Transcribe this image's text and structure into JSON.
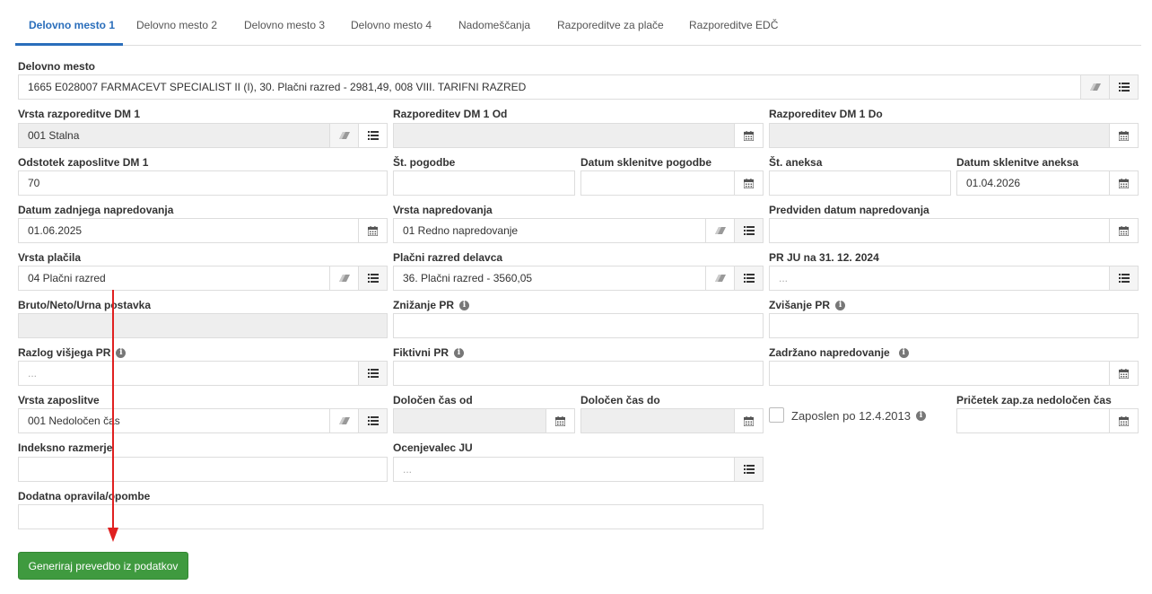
{
  "tabs": [
    {
      "label": "Delovno mesto 1",
      "active": true
    },
    {
      "label": "Delovno mesto 2"
    },
    {
      "label": "Delovno mesto 3"
    },
    {
      "label": "Delovno mesto 4"
    },
    {
      "label": "Nadomeščanja"
    },
    {
      "label": "Razporeditve za plače"
    },
    {
      "label": "Razporeditve EDČ"
    }
  ],
  "form": {
    "delovno_mesto": {
      "label": "Delovno mesto",
      "value": "1665 E028007 FARMACEVT SPECIALIST II (I),    30. Plačni razred - 2981,49,  008 VIII. TARIFNI RAZRED"
    },
    "vrsta_razporeditve": {
      "label": "Vrsta razporeditve DM 1",
      "value": "001 Stalna"
    },
    "razporeditev_od": {
      "label": "Razporeditev DM 1 Od",
      "value": ""
    },
    "razporeditev_do": {
      "label": "Razporeditev DM 1 Do",
      "value": ""
    },
    "odstotek": {
      "label": "Odstotek zaposlitve DM 1",
      "value": "70"
    },
    "st_pogodbe": {
      "label": "Št. pogodbe",
      "value": ""
    },
    "datum_pogodbe": {
      "label": "Datum sklenitve pogodbe",
      "value": ""
    },
    "st_aneksa": {
      "label": "Št. aneksa",
      "value": ""
    },
    "datum_aneksa": {
      "label": "Datum sklenitve aneksa",
      "value": "01.04.2026"
    },
    "datum_zadnjega": {
      "label": "Datum zadnjega napredovanja",
      "value": "01.06.2025"
    },
    "vrsta_napredovanja": {
      "label": "Vrsta napredovanja",
      "value": "01 Redno napredovanje"
    },
    "predviden_datum": {
      "label": "Predviden datum napredovanja",
      "value": ""
    },
    "vrsta_placila": {
      "label": "Vrsta plačila",
      "value": "04 Plačni razred"
    },
    "placni_razred": {
      "label": "Plačni razred delavca",
      "value": "36. Plačni razred - 3560,05"
    },
    "pr_ju": {
      "label": "PR JU na 31. 12. 2024",
      "placeholder": "..."
    },
    "bruto": {
      "label": "Bruto/Neto/Urna postavka",
      "value": ""
    },
    "znizanje": {
      "label": "Znižanje PR",
      "value": ""
    },
    "zvisanje": {
      "label": "Zvišanje PR",
      "value": ""
    },
    "razlog": {
      "label": "Razlog višjega PR",
      "placeholder": "..."
    },
    "fiktivni": {
      "label": "Fiktivni PR",
      "value": ""
    },
    "zadrzano": {
      "label": "Zadržano napredovanje",
      "value": ""
    },
    "vrsta_zaposlitve": {
      "label": "Vrsta zaposlitve",
      "value": "001 Nedoločen čas"
    },
    "dolocen_od": {
      "label": "Določen čas od",
      "value": ""
    },
    "dolocen_do": {
      "label": "Določen čas do",
      "value": ""
    },
    "zaposlen_po": {
      "label": "Zaposlen po 12.4.2013",
      "checked": false
    },
    "pricetek": {
      "label": "Pričetek zap.za nedoločen čas",
      "value": ""
    },
    "indeksno": {
      "label": "Indeksno razmerje",
      "value": ""
    },
    "ocenjevalec": {
      "label": "Ocenjevalec JU",
      "placeholder": "..."
    },
    "dodatna": {
      "label": "Dodatna opravila/opombe",
      "value": ""
    }
  },
  "generate_button": "Generiraj prevedbo iz podatkov",
  "info_icon": "i",
  "colors": {
    "tab_active": "#2a6ebb",
    "button_green": "#3f9a3f",
    "arrow": "#e02020",
    "disabled_bg": "#eeeeee"
  }
}
